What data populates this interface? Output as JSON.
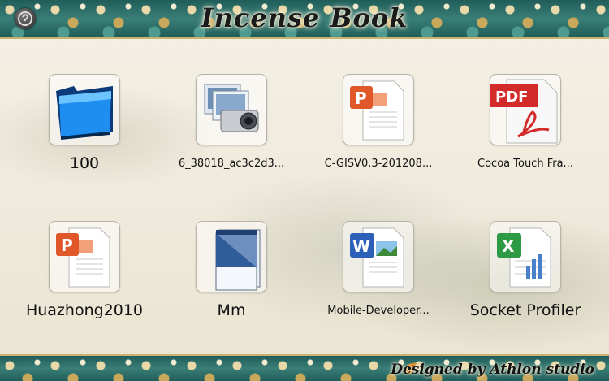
{
  "header": {
    "title": "Incense Book",
    "info_icon": "info-icon"
  },
  "files": [
    {
      "name": "100",
      "icon": "folder-icon"
    },
    {
      "name": "6_38018_ac3c2d3...",
      "icon": "camera-photo-icon"
    },
    {
      "name": "C-GISV0.3-201208...",
      "icon": "powerpoint-document-icon"
    },
    {
      "name": "Cocoa Touch Fra...",
      "icon": "pdf-document-icon",
      "badge": "PDF"
    },
    {
      "name": "Huazhong2010",
      "icon": "powerpoint-document-icon"
    },
    {
      "name": "Mm",
      "icon": "notepad-icon"
    },
    {
      "name": "Mobile-Developer...",
      "icon": "word-document-icon"
    },
    {
      "name": "Socket Profiler",
      "icon": "excel-document-icon"
    }
  ],
  "footer": {
    "credit": "Designed by Athlon studio",
    "logo_icon": "studio-logo-icon"
  },
  "colors": {
    "band": "#2f6f6a",
    "trim": "#c9b36e",
    "folder_blue": "#1e8ef0",
    "ppt_orange": "#e0582a",
    "pdf_red": "#d32a2a",
    "word_blue": "#2b5fb8",
    "excel_green": "#2f9a44"
  }
}
